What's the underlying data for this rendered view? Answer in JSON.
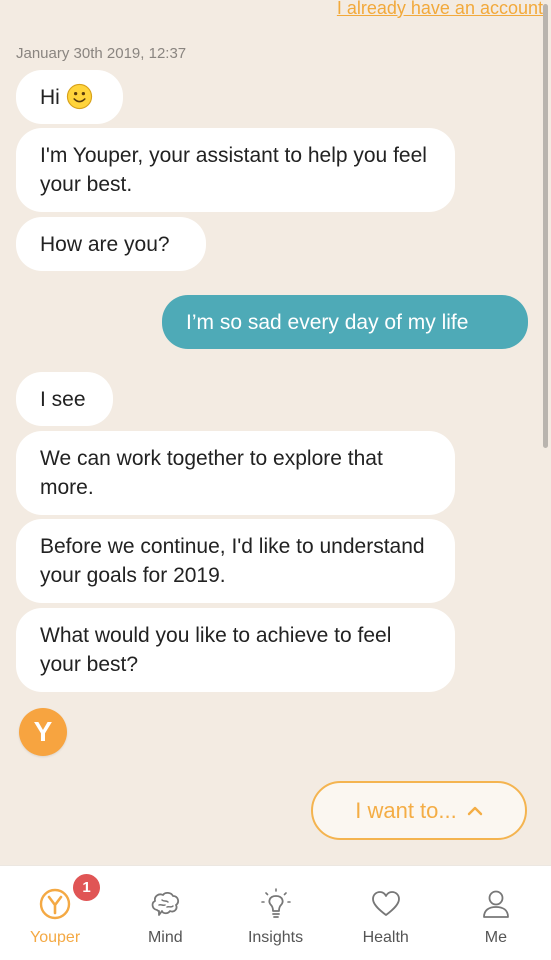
{
  "header": {
    "account_link": "I already have an account"
  },
  "chat": {
    "timestamp": "January 30th 2019, 12:37",
    "messages": [
      {
        "from": "bot",
        "text": "Hi"
      },
      {
        "from": "bot",
        "text": "I'm Youper, your assistant to help you feel your best."
      },
      {
        "from": "bot",
        "text": "How are you?"
      },
      {
        "from": "user",
        "text": "I’m so sad every day of my life"
      },
      {
        "from": "bot",
        "text": "I see"
      },
      {
        "from": "bot",
        "text": "We can work together to explore that more."
      },
      {
        "from": "bot",
        "text": "Before we continue, I'd like to understand your goals for 2019."
      },
      {
        "from": "bot",
        "text": "What would you like to achieve to feel your best?"
      }
    ],
    "avatar_letter": "Y"
  },
  "reply_button": {
    "label": "I want to...",
    "icon": "chevron-up-icon"
  },
  "tabs": [
    {
      "label": "Youper",
      "icon": "youper-logo-icon",
      "badge": "1",
      "active": true
    },
    {
      "label": "Mind",
      "icon": "brain-icon"
    },
    {
      "label": "Insights",
      "icon": "lightbulb-icon"
    },
    {
      "label": "Health",
      "icon": "heart-icon"
    },
    {
      "label": "Me",
      "icon": "person-icon"
    }
  ],
  "colors": {
    "background": "#f3ebe2",
    "accent": "#f4a944",
    "user_bubble": "#4eaab7",
    "badge": "#e05555"
  }
}
